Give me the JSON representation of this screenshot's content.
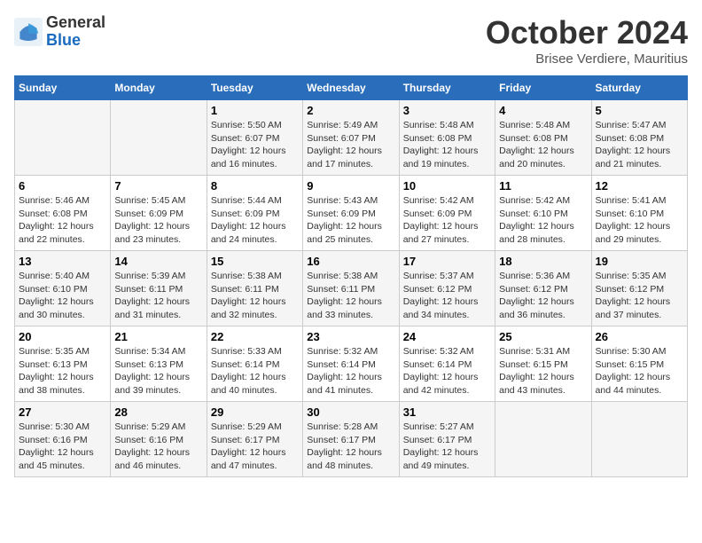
{
  "header": {
    "logo": {
      "general": "General",
      "blue": "Blue"
    },
    "month": "October 2024",
    "location": "Brisee Verdiere, Mauritius"
  },
  "weekdays": [
    "Sunday",
    "Monday",
    "Tuesday",
    "Wednesday",
    "Thursday",
    "Friday",
    "Saturday"
  ],
  "weeks": [
    [
      {
        "day": "",
        "info": ""
      },
      {
        "day": "",
        "info": ""
      },
      {
        "day": "1",
        "info": "Sunrise: 5:50 AM\nSunset: 6:07 PM\nDaylight: 12 hours and 16 minutes."
      },
      {
        "day": "2",
        "info": "Sunrise: 5:49 AM\nSunset: 6:07 PM\nDaylight: 12 hours and 17 minutes."
      },
      {
        "day": "3",
        "info": "Sunrise: 5:48 AM\nSunset: 6:08 PM\nDaylight: 12 hours and 19 minutes."
      },
      {
        "day": "4",
        "info": "Sunrise: 5:48 AM\nSunset: 6:08 PM\nDaylight: 12 hours and 20 minutes."
      },
      {
        "day": "5",
        "info": "Sunrise: 5:47 AM\nSunset: 6:08 PM\nDaylight: 12 hours and 21 minutes."
      }
    ],
    [
      {
        "day": "6",
        "info": "Sunrise: 5:46 AM\nSunset: 6:08 PM\nDaylight: 12 hours and 22 minutes."
      },
      {
        "day": "7",
        "info": "Sunrise: 5:45 AM\nSunset: 6:09 PM\nDaylight: 12 hours and 23 minutes."
      },
      {
        "day": "8",
        "info": "Sunrise: 5:44 AM\nSunset: 6:09 PM\nDaylight: 12 hours and 24 minutes."
      },
      {
        "day": "9",
        "info": "Sunrise: 5:43 AM\nSunset: 6:09 PM\nDaylight: 12 hours and 25 minutes."
      },
      {
        "day": "10",
        "info": "Sunrise: 5:42 AM\nSunset: 6:09 PM\nDaylight: 12 hours and 27 minutes."
      },
      {
        "day": "11",
        "info": "Sunrise: 5:42 AM\nSunset: 6:10 PM\nDaylight: 12 hours and 28 minutes."
      },
      {
        "day": "12",
        "info": "Sunrise: 5:41 AM\nSunset: 6:10 PM\nDaylight: 12 hours and 29 minutes."
      }
    ],
    [
      {
        "day": "13",
        "info": "Sunrise: 5:40 AM\nSunset: 6:10 PM\nDaylight: 12 hours and 30 minutes."
      },
      {
        "day": "14",
        "info": "Sunrise: 5:39 AM\nSunset: 6:11 PM\nDaylight: 12 hours and 31 minutes."
      },
      {
        "day": "15",
        "info": "Sunrise: 5:38 AM\nSunset: 6:11 PM\nDaylight: 12 hours and 32 minutes."
      },
      {
        "day": "16",
        "info": "Sunrise: 5:38 AM\nSunset: 6:11 PM\nDaylight: 12 hours and 33 minutes."
      },
      {
        "day": "17",
        "info": "Sunrise: 5:37 AM\nSunset: 6:12 PM\nDaylight: 12 hours and 34 minutes."
      },
      {
        "day": "18",
        "info": "Sunrise: 5:36 AM\nSunset: 6:12 PM\nDaylight: 12 hours and 36 minutes."
      },
      {
        "day": "19",
        "info": "Sunrise: 5:35 AM\nSunset: 6:12 PM\nDaylight: 12 hours and 37 minutes."
      }
    ],
    [
      {
        "day": "20",
        "info": "Sunrise: 5:35 AM\nSunset: 6:13 PM\nDaylight: 12 hours and 38 minutes."
      },
      {
        "day": "21",
        "info": "Sunrise: 5:34 AM\nSunset: 6:13 PM\nDaylight: 12 hours and 39 minutes."
      },
      {
        "day": "22",
        "info": "Sunrise: 5:33 AM\nSunset: 6:14 PM\nDaylight: 12 hours and 40 minutes."
      },
      {
        "day": "23",
        "info": "Sunrise: 5:32 AM\nSunset: 6:14 PM\nDaylight: 12 hours and 41 minutes."
      },
      {
        "day": "24",
        "info": "Sunrise: 5:32 AM\nSunset: 6:14 PM\nDaylight: 12 hours and 42 minutes."
      },
      {
        "day": "25",
        "info": "Sunrise: 5:31 AM\nSunset: 6:15 PM\nDaylight: 12 hours and 43 minutes."
      },
      {
        "day": "26",
        "info": "Sunrise: 5:30 AM\nSunset: 6:15 PM\nDaylight: 12 hours and 44 minutes."
      }
    ],
    [
      {
        "day": "27",
        "info": "Sunrise: 5:30 AM\nSunset: 6:16 PM\nDaylight: 12 hours and 45 minutes."
      },
      {
        "day": "28",
        "info": "Sunrise: 5:29 AM\nSunset: 6:16 PM\nDaylight: 12 hours and 46 minutes."
      },
      {
        "day": "29",
        "info": "Sunrise: 5:29 AM\nSunset: 6:17 PM\nDaylight: 12 hours and 47 minutes."
      },
      {
        "day": "30",
        "info": "Sunrise: 5:28 AM\nSunset: 6:17 PM\nDaylight: 12 hours and 48 minutes."
      },
      {
        "day": "31",
        "info": "Sunrise: 5:27 AM\nSunset: 6:17 PM\nDaylight: 12 hours and 49 minutes."
      },
      {
        "day": "",
        "info": ""
      },
      {
        "day": "",
        "info": ""
      }
    ]
  ]
}
